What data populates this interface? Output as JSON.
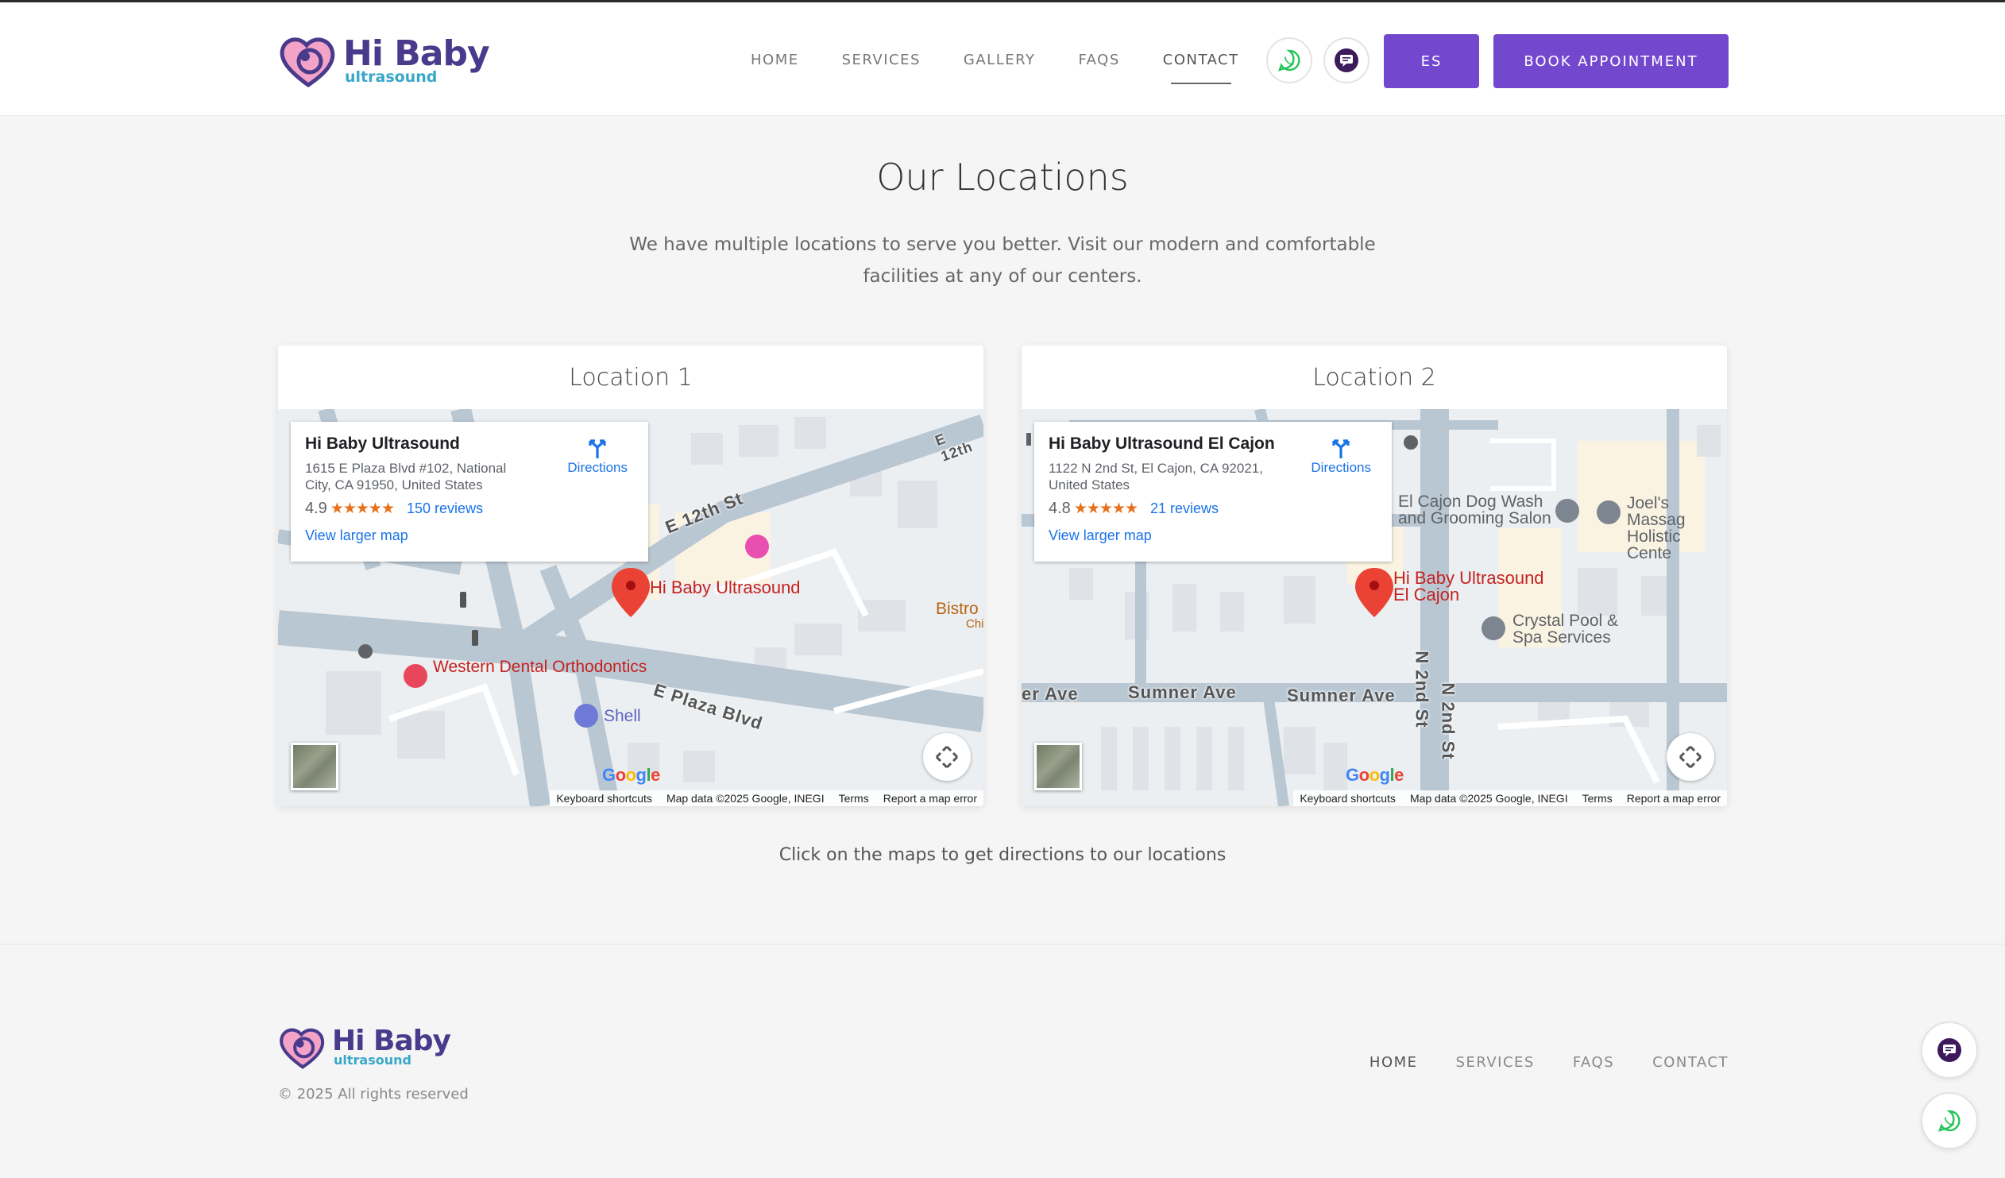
{
  "brand": {
    "name": "Hi Baby",
    "tagline": "ultrasound"
  },
  "nav": {
    "items": [
      {
        "label": "HOME"
      },
      {
        "label": "SERVICES"
      },
      {
        "label": "GALLERY"
      },
      {
        "label": "FAQS"
      },
      {
        "label": "CONTACT",
        "active": true
      }
    ],
    "icons": [
      "whatsapp-icon",
      "chat-icon"
    ],
    "lang_label": "ES",
    "book_label": "BOOK APPOINTMENT"
  },
  "main": {
    "title": "Our Locations",
    "subtitle": "We have multiple locations to serve you better. Visit our modern and comfortable facilities at any of our centers.",
    "note": "Click on the maps to get directions to our locations"
  },
  "locations": [
    {
      "heading": "Location 1",
      "name": "Hi Baby Ultrasound",
      "address": "1615 E Plaza Blvd #102, National City, CA 91950, United States",
      "rating": "4.9",
      "stars": "★★★★★",
      "reviews": "150 reviews",
      "directions": "Directions",
      "larger_map": "View larger map",
      "marker_label": "Hi Baby Ultrasound",
      "roads": [
        "E 12th St",
        "E Plaza Blvd",
        "E 12th"
      ],
      "places": [
        "Western Dental Orthodontics",
        "Shell",
        "Bistro",
        "Chi"
      ]
    },
    {
      "heading": "Location 2",
      "name": "Hi Baby Ultrasound El Cajon",
      "address": "1122 N 2nd St, El Cajon, CA 92021, United States",
      "rating": "4.8",
      "stars": "★★★★★",
      "reviews": "21 reviews",
      "directions": "Directions",
      "larger_map": "View larger map",
      "marker_label_1": "Hi Baby Ultrasound",
      "marker_label_2": "El Cajon",
      "roads": [
        "Sumner Ave",
        "Sumner Ave",
        "er Ave",
        "N 2nd St",
        "N 2nd St"
      ],
      "places": [
        "El Cajon Dog Wash",
        "and Grooming Salon",
        "Joel's Massag",
        "Holistic Cente",
        "Crystal Pool &",
        "Spa Services"
      ]
    }
  ],
  "map_common": {
    "google": "Google",
    "shortcuts": "Keyboard shortcuts",
    "map_data": "Map data ©2025 Google, INEGI",
    "terms": "Terms",
    "report": "Report a map error"
  },
  "footer": {
    "copyright": "© 2025 All rights reserved",
    "nav": [
      {
        "label": "HOME",
        "active": true
      },
      {
        "label": "SERVICES"
      },
      {
        "label": "FAQS"
      },
      {
        "label": "CONTACT"
      }
    ]
  },
  "colors": {
    "accent": "#7447cf",
    "brand_dark": "#4a3a8c",
    "brand_light": "#38a8c8",
    "pin": "#ea4335",
    "link": "#1a73e8"
  }
}
